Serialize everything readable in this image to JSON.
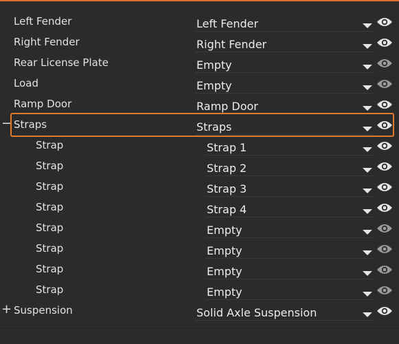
{
  "colors": {
    "accent": "#e07b2d",
    "background": "#2b2b2b",
    "text": "#e6e6e6",
    "eye_dim": "#9a9a9a"
  },
  "rows": [
    {
      "label": "Left Fender",
      "value": "Left Fender",
      "eye": "bright"
    },
    {
      "label": "Right Fender",
      "value": "Right Fender",
      "eye": "bright"
    },
    {
      "label": "Rear License Plate",
      "value": "Empty",
      "eye": "dim"
    },
    {
      "label": "Load",
      "value": "Empty",
      "eye": "dim"
    },
    {
      "label": "Ramp Door",
      "value": "Ramp Door",
      "eye": "bright"
    },
    {
      "label": "Straps",
      "value": "Straps",
      "eye": "bright",
      "expander": "−",
      "selected": true
    },
    {
      "label": "Strap",
      "value": "Strap 1",
      "eye": "bright",
      "child": true
    },
    {
      "label": "Strap",
      "value": "Strap 2",
      "eye": "bright",
      "child": true
    },
    {
      "label": "Strap",
      "value": "Strap 3",
      "eye": "bright",
      "child": true
    },
    {
      "label": "Strap",
      "value": "Strap 4",
      "eye": "bright",
      "child": true
    },
    {
      "label": "Strap",
      "value": "Empty",
      "eye": "dim",
      "child": true
    },
    {
      "label": "Strap",
      "value": "Empty",
      "eye": "dim",
      "child": true
    },
    {
      "label": "Strap",
      "value": "Empty",
      "eye": "dim",
      "child": true
    },
    {
      "label": "Strap",
      "value": "Empty",
      "eye": "dim",
      "child": true
    },
    {
      "label": "Suspension",
      "value": "Solid Axle Suspension",
      "eye": "bright",
      "expander": "+"
    }
  ]
}
